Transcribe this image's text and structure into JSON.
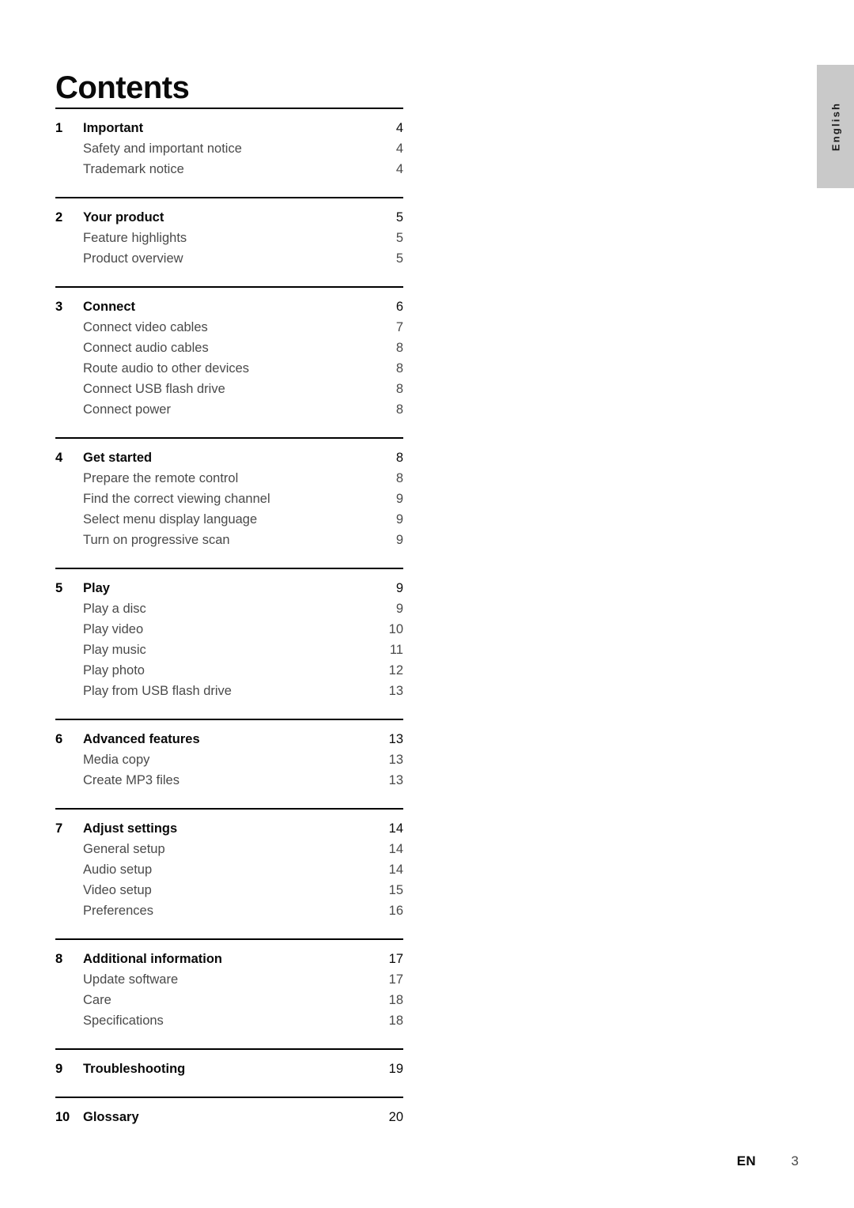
{
  "document": {
    "title": "Contents",
    "language_tab": "English",
    "footer": {
      "language_code": "EN",
      "page_number": "3"
    }
  },
  "toc": {
    "sections": [
      {
        "number": "1",
        "title": "Important",
        "page": "4",
        "entries": [
          {
            "title": "Safety and important notice",
            "page": "4"
          },
          {
            "title": "Trademark notice",
            "page": "4"
          }
        ]
      },
      {
        "number": "2",
        "title": "Your product",
        "page": "5",
        "entries": [
          {
            "title": "Feature highlights",
            "page": "5"
          },
          {
            "title": "Product overview",
            "page": "5"
          }
        ]
      },
      {
        "number": "3",
        "title": "Connect",
        "page": "6",
        "entries": [
          {
            "title": "Connect video cables",
            "page": "7"
          },
          {
            "title": "Connect audio cables",
            "page": "8"
          },
          {
            "title": "Route audio to other devices",
            "page": "8"
          },
          {
            "title": "Connect USB flash drive",
            "page": "8"
          },
          {
            "title": "Connect power",
            "page": "8"
          }
        ]
      },
      {
        "number": "4",
        "title": "Get started",
        "page": "8",
        "entries": [
          {
            "title": "Prepare the remote control",
            "page": "8"
          },
          {
            "title": "Find the correct viewing channel",
            "page": "9"
          },
          {
            "title": "Select menu display language",
            "page": "9"
          },
          {
            "title": "Turn on progressive scan",
            "page": "9"
          }
        ]
      },
      {
        "number": "5",
        "title": "Play",
        "page": "9",
        "entries": [
          {
            "title": "Play a disc",
            "page": "9"
          },
          {
            "title": "Play video",
            "page": "10"
          },
          {
            "title": "Play music",
            "page": "11"
          },
          {
            "title": "Play photo",
            "page": "12"
          },
          {
            "title": "Play from USB flash drive",
            "page": "13"
          }
        ]
      },
      {
        "number": "6",
        "title": "Advanced features",
        "page": "13",
        "entries": [
          {
            "title": "Media copy",
            "page": "13"
          },
          {
            "title": "Create MP3 files",
            "page": "13"
          }
        ]
      },
      {
        "number": "7",
        "title": "Adjust settings",
        "page": "14",
        "entries": [
          {
            "title": "General setup",
            "page": "14"
          },
          {
            "title": "Audio setup",
            "page": "14"
          },
          {
            "title": "Video setup",
            "page": "15"
          },
          {
            "title": "Preferences",
            "page": "16"
          }
        ]
      },
      {
        "number": "8",
        "title": "Additional information",
        "page": "17",
        "entries": [
          {
            "title": "Update software",
            "page": "17"
          },
          {
            "title": "Care",
            "page": "18"
          },
          {
            "title": "Specifications",
            "page": "18"
          }
        ]
      },
      {
        "number": "9",
        "title": "Troubleshooting",
        "page": "19",
        "entries": []
      },
      {
        "number": "10",
        "title": "Glossary",
        "page": "20",
        "entries": []
      }
    ]
  }
}
